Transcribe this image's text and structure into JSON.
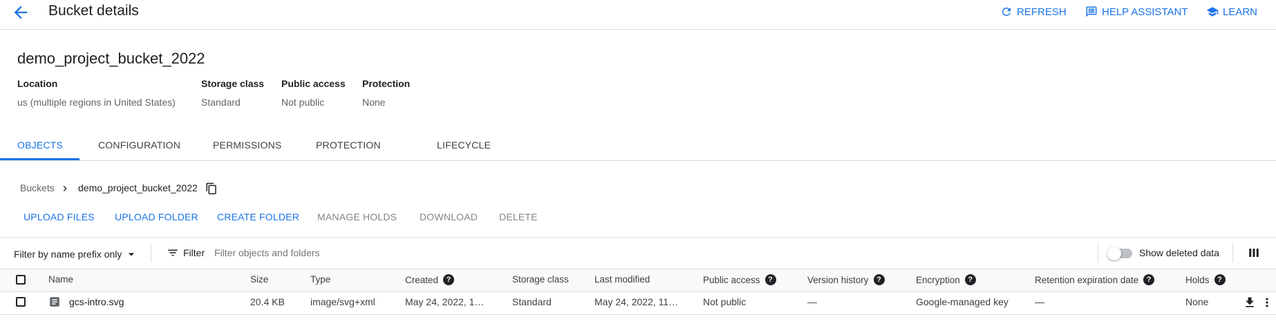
{
  "header": {
    "title": "Bucket details",
    "refresh_label": "REFRESH",
    "help_label": "HELP ASSISTANT",
    "learn_label": "LEARN"
  },
  "bucket": {
    "name": "demo_project_bucket_2022",
    "meta": [
      {
        "label": "Location",
        "value": "us (multiple regions in United States)"
      },
      {
        "label": "Storage class",
        "value": "Standard"
      },
      {
        "label": "Public access",
        "value": "Not public"
      },
      {
        "label": "Protection",
        "value": "None"
      }
    ]
  },
  "tabs": [
    {
      "label": "OBJECTS",
      "active": true
    },
    {
      "label": "CONFIGURATION"
    },
    {
      "label": "PERMISSIONS"
    },
    {
      "label": "PROTECTION"
    },
    {
      "label": "LIFECYCLE"
    }
  ],
  "breadcrumb": {
    "root": "Buckets",
    "current": "demo_project_bucket_2022"
  },
  "actions": [
    {
      "label": "UPLOAD FILES",
      "enabled": true
    },
    {
      "label": "UPLOAD FOLDER",
      "enabled": true
    },
    {
      "label": "CREATE FOLDER",
      "enabled": true
    },
    {
      "label": "MANAGE HOLDS",
      "enabled": false
    },
    {
      "label": "DOWNLOAD",
      "enabled": false
    },
    {
      "label": "DELETE",
      "enabled": false
    }
  ],
  "filter_bar": {
    "prefix_dropdown": "Filter by name prefix only",
    "filter_label": "Filter",
    "filter_placeholder": "Filter objects and folders",
    "show_deleted_label": "Show deleted data",
    "show_deleted_on": false
  },
  "table": {
    "columns": [
      "Name",
      "Size",
      "Type",
      "Created",
      "Storage class",
      "Last modified",
      "Public access",
      "Version history",
      "Encryption",
      "Retention expiration date",
      "Holds"
    ],
    "rows": [
      {
        "name": "gcs-intro.svg",
        "size": "20.4 KB",
        "type": "image/svg+xml",
        "created": "May 24, 2022, 1…",
        "storage_class": "Standard",
        "last_modified": "May 24, 2022, 11…",
        "public_access": "Not public",
        "version_history": "—",
        "encryption": "Google-managed key",
        "retention": "—",
        "holds": "None"
      }
    ]
  },
  "icons": {
    "accent": "#1a73e8",
    "names": [
      "arrow-back-icon",
      "refresh-icon",
      "chat-icon",
      "school-icon",
      "chevron-right-icon",
      "copy-icon",
      "caret-down-icon",
      "filter-lines-icon",
      "help-icon",
      "file-icon",
      "download-icon",
      "more-vert-icon",
      "column-display-icon"
    ]
  }
}
